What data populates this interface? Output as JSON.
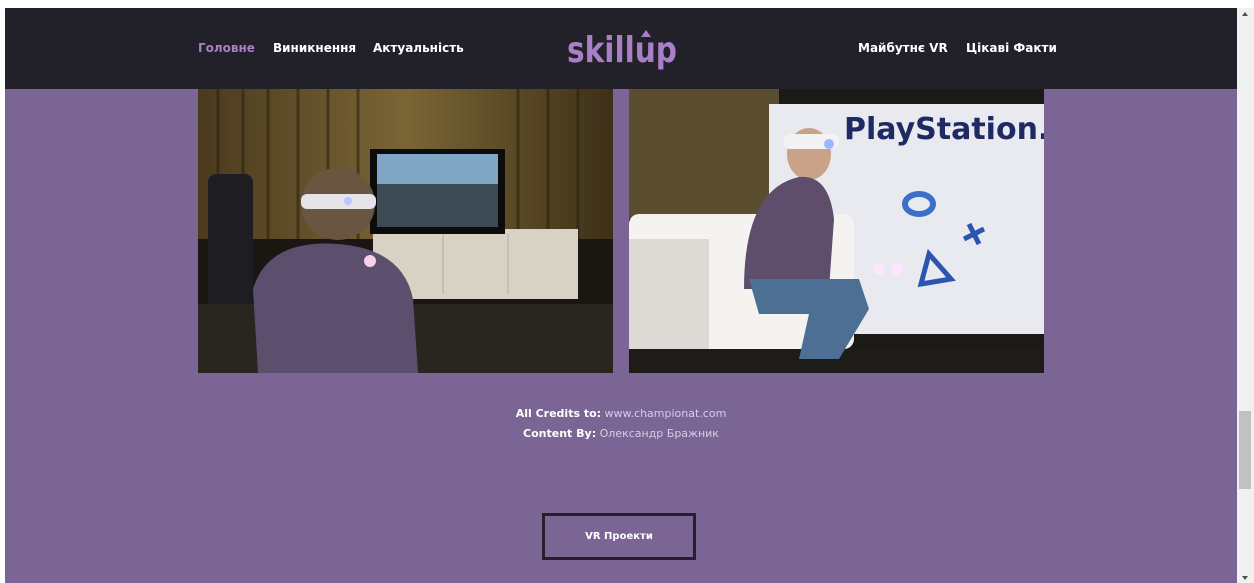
{
  "nav": {
    "left": [
      {
        "label": "Головне",
        "active": true
      },
      {
        "label": "Виникнення",
        "active": false
      },
      {
        "label": "Актуальність",
        "active": false
      }
    ],
    "right": [
      {
        "label": "Майбутнє VR",
        "active": false
      },
      {
        "label": "Цікаві Факти",
        "active": false
      }
    ],
    "logo_text": "skillup"
  },
  "photos": {
    "right_banner_text": "PlayStation.VR"
  },
  "credits": {
    "label1": "All Credits to:",
    "value1": "www.championat.com",
    "label2": "Content By:",
    "value2": "Олександр Бражник"
  },
  "button": {
    "label": "VR Проекти"
  },
  "colors": {
    "background": "#7b6595",
    "header": "#22212a",
    "accent": "#a97fc7",
    "button_border": "#25202d"
  }
}
